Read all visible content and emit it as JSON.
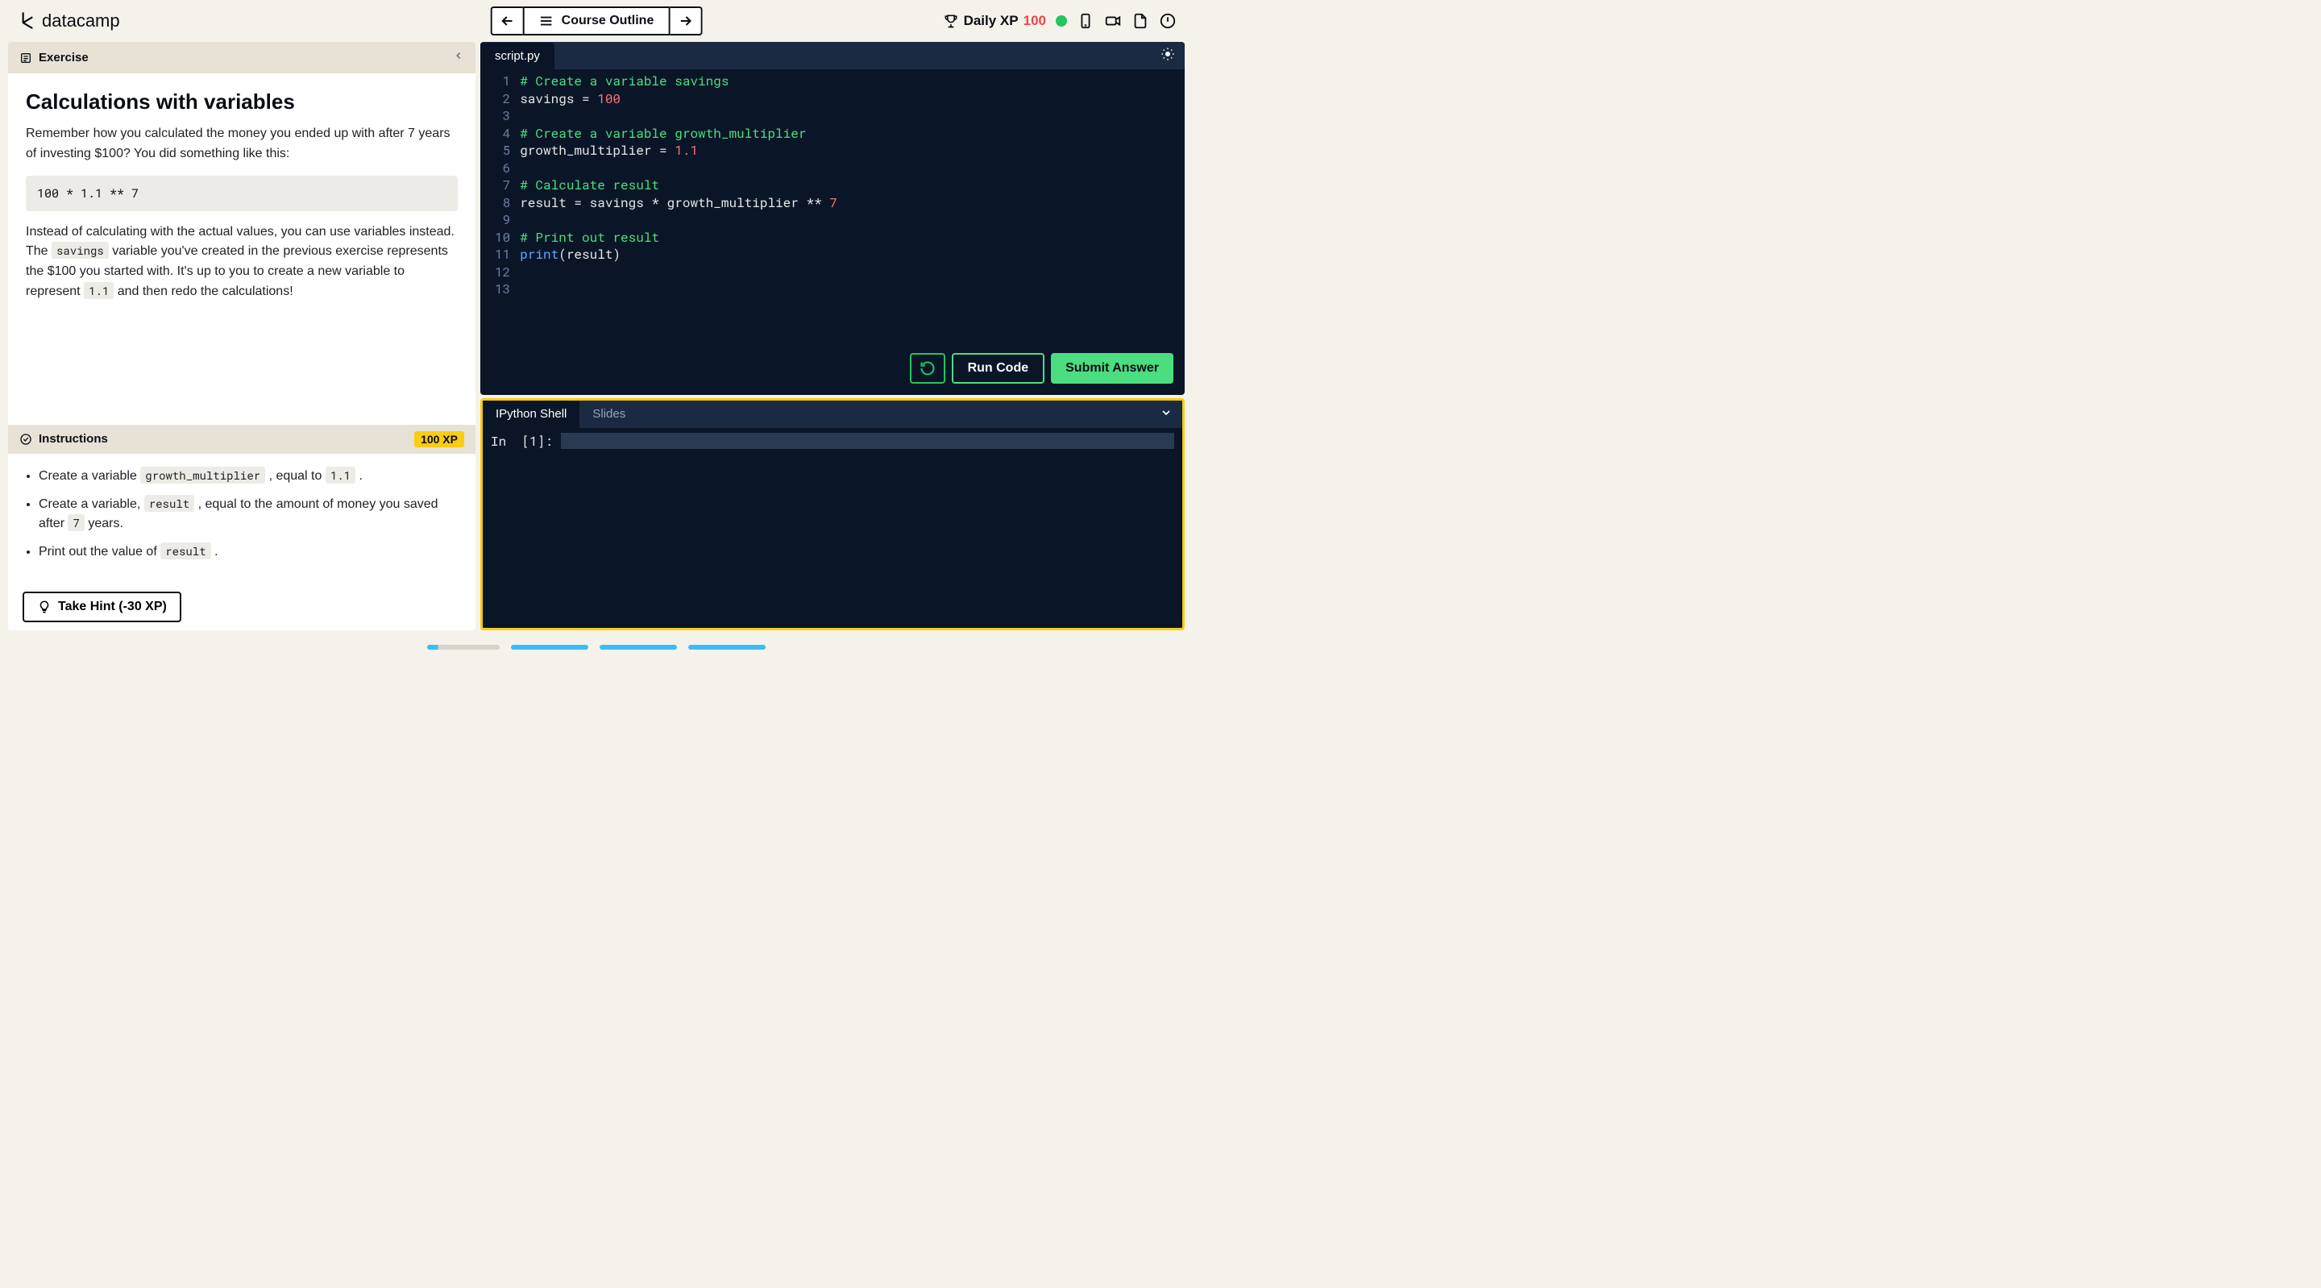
{
  "header": {
    "brand": "datacamp",
    "course_outline": "Course Outline",
    "daily_xp_label": "Daily XP",
    "daily_xp_value": "100"
  },
  "exercise": {
    "label": "Exercise",
    "title": "Calculations with variables",
    "para1": "Remember how you calculated the money you ended up with after 7 years of investing $100? You did something like this:",
    "code_sample": "100 * 1.1 ** 7",
    "para2_a": "Instead of calculating with the actual values, you can use variables instead. The ",
    "para2_code1": "savings",
    "para2_b": " variable you've created in the previous exercise represents the $100 you started with. It's up to you to create a new variable to represent ",
    "para2_code2": "1.1",
    "para2_c": " and then redo the calculations!"
  },
  "instructions": {
    "label": "Instructions",
    "xp": "100 XP",
    "items": {
      "i1a": "Create a variable ",
      "i1code": "growth_multiplier",
      "i1b": " , equal to ",
      "i1code2": "1.1",
      "i1c": " .",
      "i2a": "Create a variable, ",
      "i2code": "result",
      "i2b": " , equal to the amount of money you saved after ",
      "i2code2": "7",
      "i2c": " years.",
      "i3a": "Print out the value of ",
      "i3code": "result",
      "i3b": " ."
    },
    "hint_label": "Take Hint (-30 XP)"
  },
  "editor": {
    "filename": "script.py",
    "run_label": "Run Code",
    "submit_label": "Submit Answer",
    "line_numbers": [
      "1",
      "2",
      "3",
      "4",
      "5",
      "6",
      "7",
      "8",
      "9",
      "10",
      "11",
      "12",
      "13"
    ],
    "lines": {
      "l1": "# Create a variable savings",
      "l2a": "savings = ",
      "l2num": "100",
      "l4": "# Create a variable growth_multiplier",
      "l5a": "growth_multiplier = ",
      "l5num": "1.1",
      "l7": "# Calculate result",
      "l8a": "result = savings * growth_multiplier ** ",
      "l8num": "7",
      "l10": "# Print out result",
      "l11fn": "print",
      "l11rest": "(result)"
    }
  },
  "shell": {
    "tab_ipython": "IPython Shell",
    "tab_slides": "Slides",
    "prompt": "In  [1]:"
  }
}
